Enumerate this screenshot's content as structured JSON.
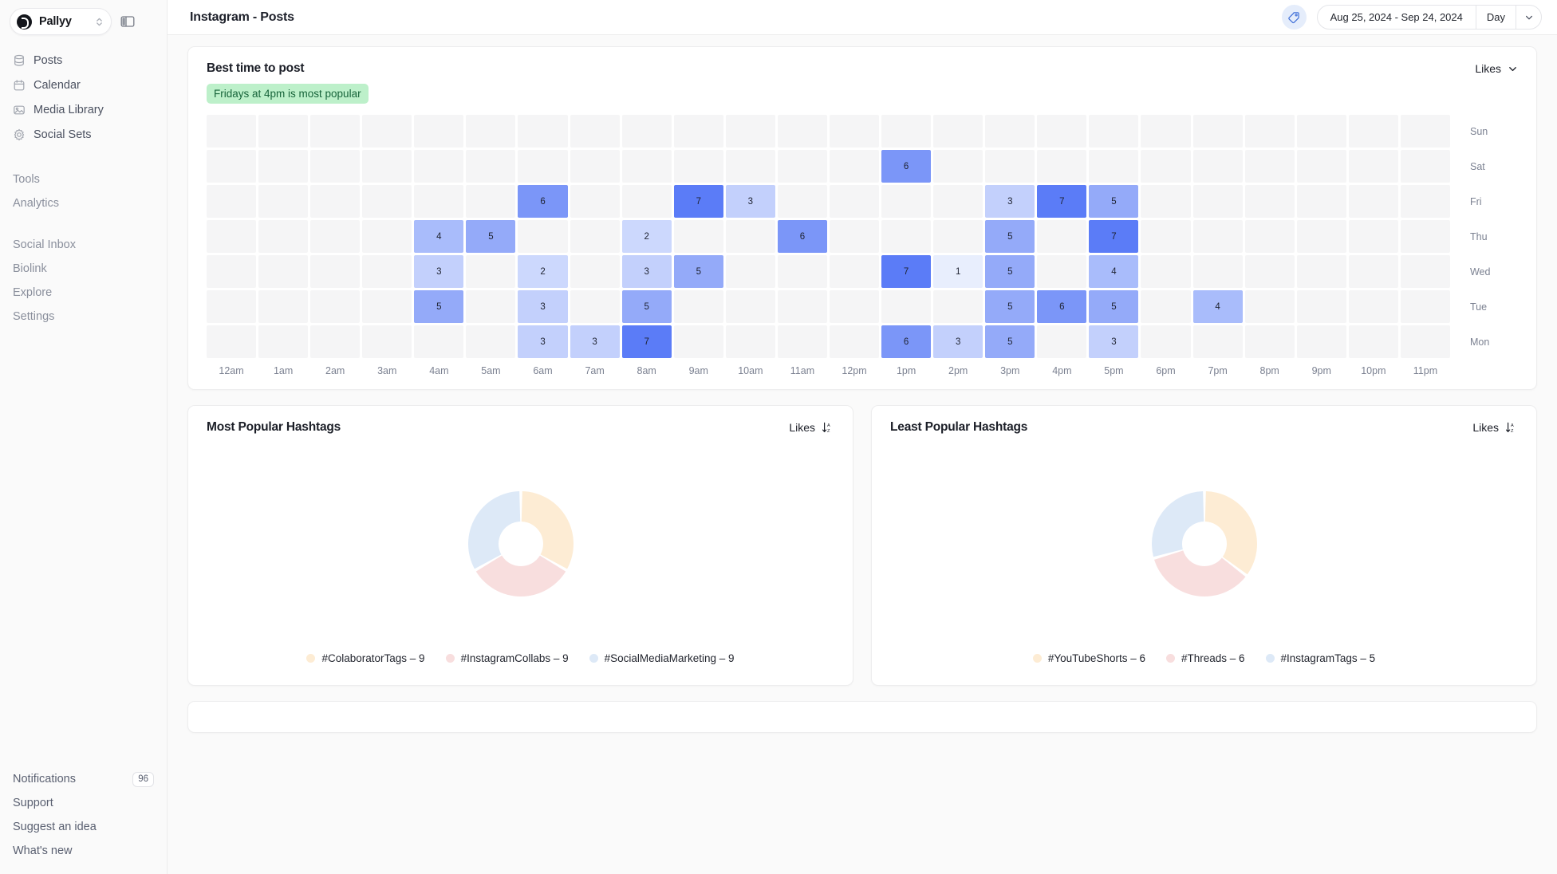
{
  "sidebar": {
    "brand": {
      "name": "Pallyy",
      "logo_icon": "pallyy-logo-icon",
      "selector_icon": "chevron-up-down-icon"
    },
    "panel_toggle_icon": "sidebar-panel-icon",
    "nav_main": [
      {
        "label": "Posts",
        "icon": "database-icon"
      },
      {
        "label": "Calendar",
        "icon": "calendar-icon"
      },
      {
        "label": "Media Library",
        "icon": "image-icon"
      },
      {
        "label": "Social Sets",
        "icon": "gear-icon"
      }
    ],
    "nav_group_tools": [
      "Tools",
      "Analytics"
    ],
    "nav_group_other": [
      "Social Inbox",
      "Biolink",
      "Explore",
      "Settings"
    ],
    "bottom": [
      {
        "label": "Notifications",
        "badge": "96"
      },
      {
        "label": "Support",
        "badge": ""
      },
      {
        "label": "Suggest an idea",
        "badge": ""
      },
      {
        "label": "What's new",
        "badge": ""
      }
    ]
  },
  "topbar": {
    "title": "Instagram - Posts",
    "tag_icon": "tag-icon",
    "date_range": "Aug 25, 2024 - Sep 24, 2024",
    "granularity": "Day",
    "caret_icon": "chevron-down-icon"
  },
  "best_time": {
    "title": "Best time to post",
    "highlight": "Fridays at 4pm is most popular",
    "metric": "Likes",
    "metric_caret_icon": "chevron-down-icon"
  },
  "colors": {
    "empty_cell": "#f5f5f6",
    "scale_1": "#e8eefd",
    "scale_2": "#ccd8fd",
    "scale_3": "#c3d0fc",
    "scale_4": "#a9bcfb",
    "scale_5": "#94aaf9",
    "scale_6": "#7b96f8",
    "scale_7": "#5b7cf7",
    "badge_green_bg": "#bdf0ca",
    "badge_green_text": "#17643a",
    "donut_orange": "#fdecd4",
    "donut_pink": "#f8dede",
    "donut_blue": "#dde9f7",
    "accent_blue": "#e5edfb"
  },
  "chart_data": [
    {
      "type": "heatmap",
      "title": "Best time to post",
      "metric": "Likes",
      "xlabel": "",
      "ylabel": "",
      "x": [
        "12am",
        "1am",
        "2am",
        "3am",
        "4am",
        "5am",
        "6am",
        "7am",
        "8am",
        "9am",
        "10am",
        "11am",
        "12pm",
        "1pm",
        "2pm",
        "3pm",
        "4pm",
        "5pm",
        "6pm",
        "7pm",
        "8pm",
        "9pm",
        "10pm",
        "11pm"
      ],
      "y": [
        "Sun",
        "Sat",
        "Fri",
        "Thu",
        "Wed",
        "Tue",
        "Mon"
      ],
      "value_range": [
        1,
        7
      ],
      "rows": [
        {
          "day": "Sun",
          "values": [
            null,
            null,
            null,
            null,
            null,
            null,
            null,
            null,
            null,
            null,
            null,
            null,
            null,
            null,
            null,
            null,
            null,
            null,
            null,
            null,
            null,
            null,
            null,
            null
          ]
        },
        {
          "day": "Sat",
          "values": [
            null,
            null,
            null,
            null,
            null,
            null,
            null,
            null,
            null,
            null,
            null,
            null,
            null,
            6,
            null,
            null,
            null,
            null,
            null,
            null,
            null,
            null,
            null,
            null
          ]
        },
        {
          "day": "Fri",
          "values": [
            null,
            null,
            null,
            null,
            null,
            null,
            6,
            null,
            null,
            7,
            3,
            null,
            null,
            null,
            null,
            3,
            7,
            5,
            null,
            null,
            null,
            null,
            null,
            null
          ]
        },
        {
          "day": "Thu",
          "values": [
            null,
            null,
            null,
            null,
            4,
            5,
            null,
            null,
            2,
            null,
            null,
            6,
            null,
            null,
            null,
            5,
            null,
            7,
            null,
            null,
            null,
            null,
            null,
            null
          ]
        },
        {
          "day": "Wed",
          "values": [
            null,
            null,
            null,
            null,
            3,
            null,
            2,
            null,
            3,
            5,
            null,
            null,
            null,
            7,
            1,
            5,
            null,
            4,
            null,
            null,
            null,
            null,
            null,
            null
          ]
        },
        {
          "day": "Tue",
          "values": [
            null,
            null,
            null,
            null,
            5,
            null,
            3,
            null,
            5,
            null,
            null,
            null,
            null,
            null,
            null,
            5,
            6,
            5,
            null,
            4,
            null,
            null,
            null,
            null
          ]
        },
        {
          "day": "Mon",
          "values": [
            null,
            null,
            null,
            null,
            null,
            null,
            3,
            3,
            7,
            null,
            null,
            null,
            null,
            6,
            3,
            5,
            null,
            3,
            null,
            null,
            null,
            null,
            null,
            null
          ]
        }
      ]
    },
    {
      "type": "pie",
      "title": "Most Popular Hashtags",
      "metric": "Likes",
      "sort_icon": "sort-descending-icon",
      "labels": [
        "#ColaboratorTags",
        "#InstagramCollabs",
        "#SocialMediaMarketing"
      ],
      "values": [
        9,
        9,
        9
      ],
      "colors": [
        "#fdecd4",
        "#f8dede",
        "#dde9f7"
      ],
      "legend": [
        "#ColaboratorTags – 9",
        "#InstagramCollabs – 9",
        "#SocialMediaMarketing – 9"
      ],
      "legend_position": "bottom"
    },
    {
      "type": "pie",
      "title": "Least Popular Hashtags",
      "metric": "Likes",
      "sort_icon": "sort-descending-icon",
      "labels": [
        "#YouTubeShorts",
        "#Threads",
        "#InstagramTags"
      ],
      "values": [
        6,
        6,
        5
      ],
      "colors": [
        "#fdecd4",
        "#f8dede",
        "#dde9f7"
      ],
      "legend": [
        "#YouTubeShorts – 6",
        "#Threads – 6",
        "#InstagramTags – 5"
      ],
      "legend_position": "bottom"
    }
  ]
}
